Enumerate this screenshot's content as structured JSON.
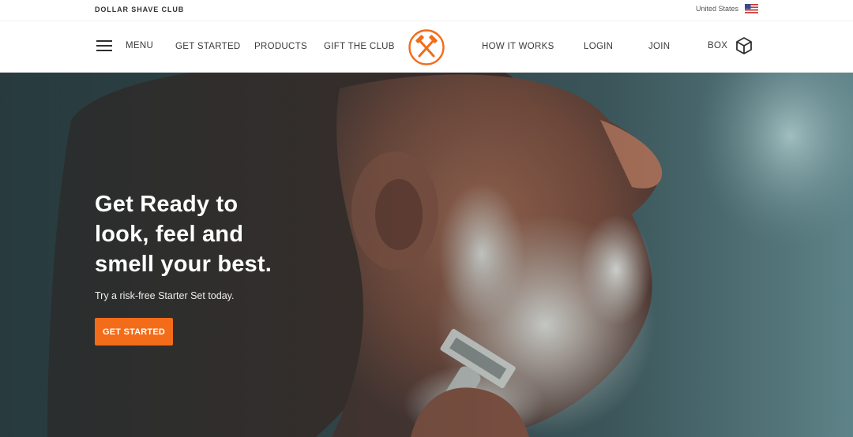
{
  "utility_bar": {
    "brand": "DOLLAR SHAVE CLUB",
    "region": "United States",
    "flag_icon": "us-flag-icon"
  },
  "nav": {
    "menu_label": "MENU",
    "menu_icon": "hamburger-icon",
    "left_links": [
      "GET STARTED",
      "PRODUCTS",
      "GIFT THE CLUB"
    ],
    "logo_icon": "crossed-hammers-logo",
    "right_links": [
      "HOW IT WORKS",
      "LOGIN",
      "JOIN"
    ],
    "box_label": "BOX",
    "box_icon": "cube-box-icon"
  },
  "hero": {
    "headline": [
      "Get Ready to",
      "look, feel and",
      "smell your best."
    ],
    "subtext": "Try a risk-free Starter Set today.",
    "cta_label": "GET STARTED",
    "image": "man-shaving-photo"
  },
  "colors": {
    "accent": "#f36c1a",
    "hero_bg": "#3b575d",
    "text": "#3a3a3a"
  }
}
